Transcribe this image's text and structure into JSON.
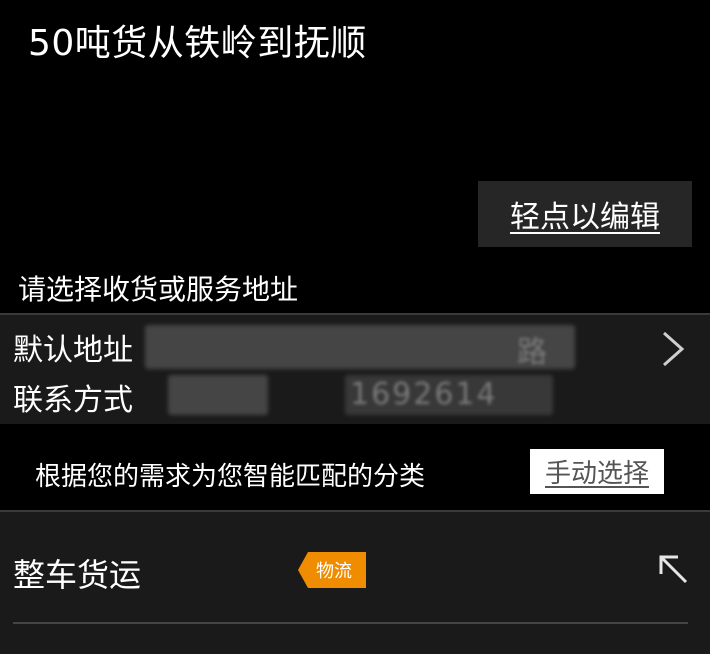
{
  "header": {
    "title": "50吨货从铁岭到抚顺",
    "edit_label": "轻点以编辑"
  },
  "address_section": {
    "label": "请选择收货或服务地址",
    "default_address_label": "默认地址",
    "default_address_value_visible": "路",
    "contact_label": "联系方式",
    "contact_phone_visible": "1692614"
  },
  "match": {
    "text": "根据您的需求为您智能匹配的分类",
    "manual_label": "手动选择"
  },
  "category": {
    "name": "整车货运",
    "tag": "物流",
    "tag_color": "#f08c00"
  },
  "icons": {
    "address_arrow": "chevron-right-icon",
    "category_arrow": "arrow-up-left-icon"
  }
}
